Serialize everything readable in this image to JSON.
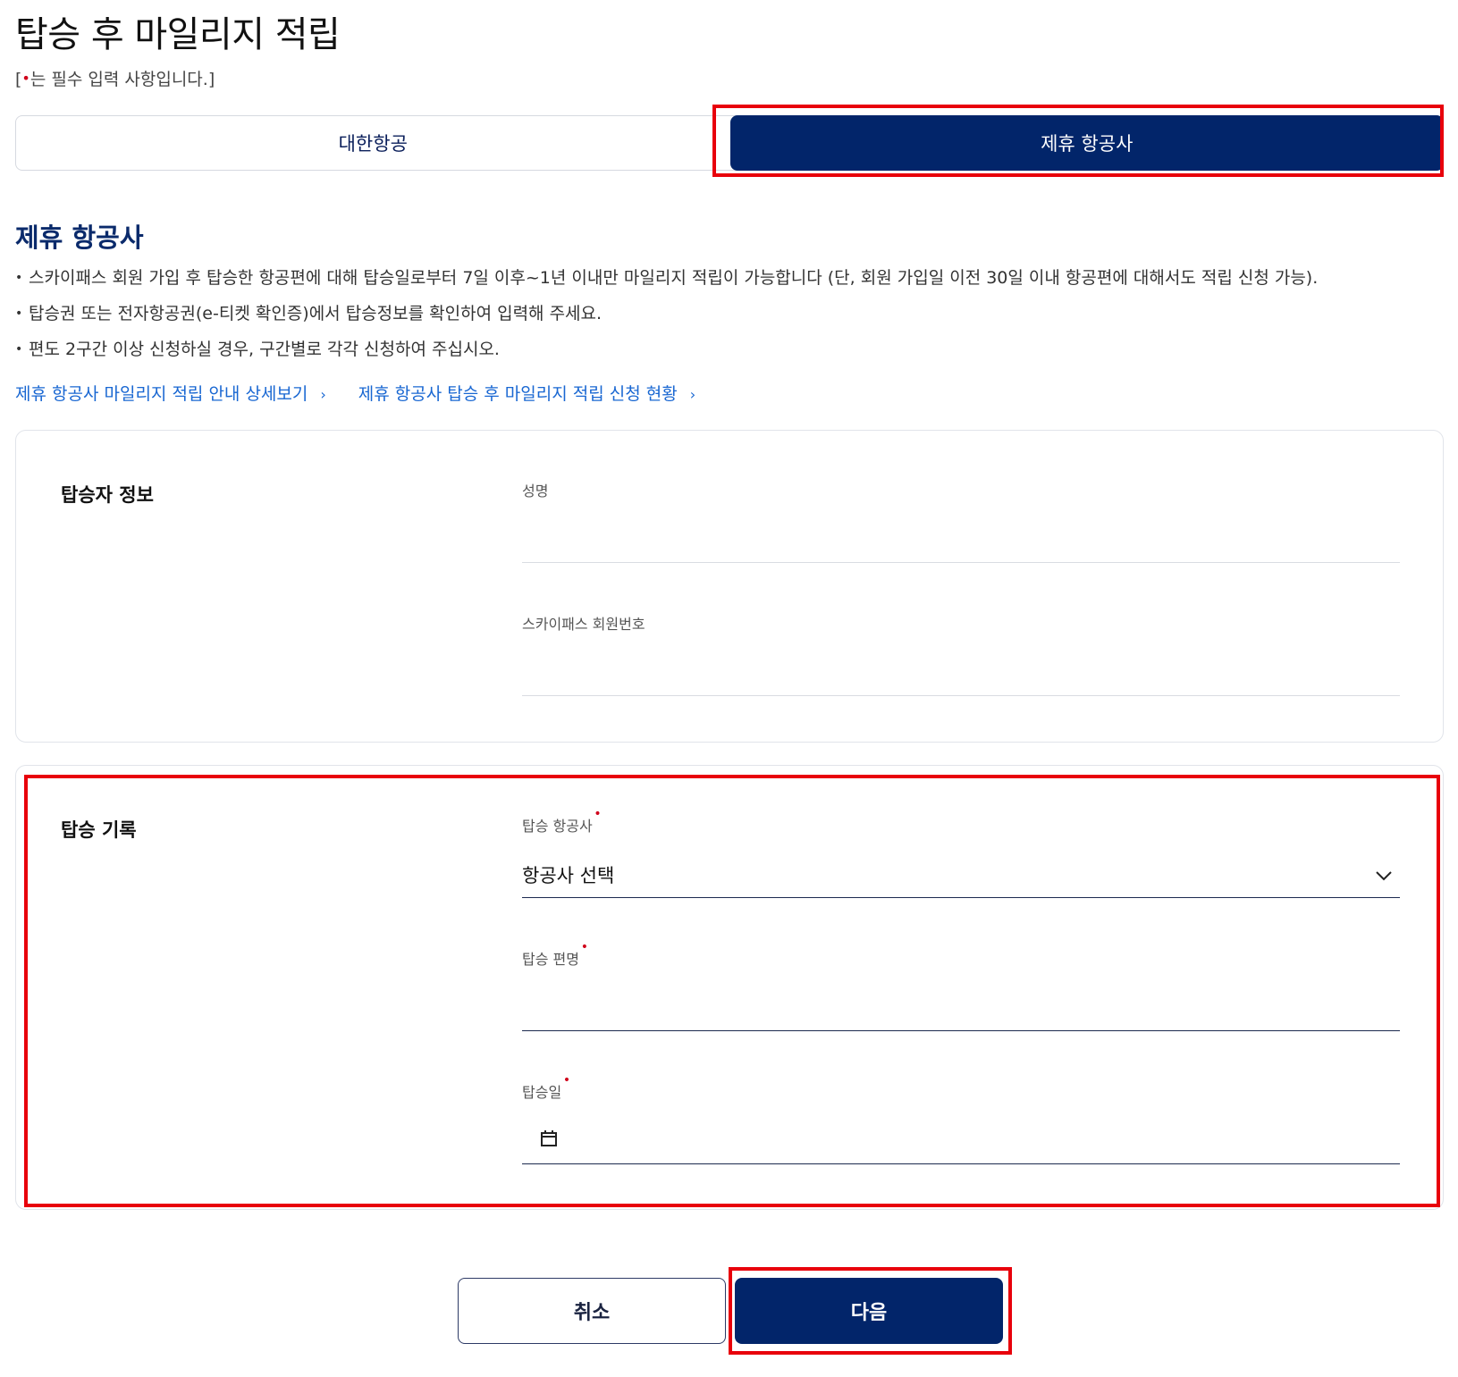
{
  "page": {
    "title": "탑승 후 마일리지 적립",
    "required_note_prefix": "[",
    "required_note_dot": "•",
    "required_note_suffix": "는 필수 입력 사항입니다.]"
  },
  "tabs": [
    {
      "label": "대한항공",
      "active": false
    },
    {
      "label": "제휴 항공사",
      "active": true
    }
  ],
  "section": {
    "title": "제휴 항공사",
    "notes": [
      "스카이패스 회원 가입 후 탑승한 항공편에 대해 탑승일로부터 7일 이후~1년 이내만 마일리지 적립이 가능합니다 (단, 회원 가입일 이전 30일 이내 항공편에 대해서도 적립 신청 가능).",
      "탑승권 또는 전자항공권(e-티켓 확인증)에서 탑승정보를 확인하여 입력해 주세요.",
      "편도 2구간 이상 신청하실 경우, 구간별로 각각 신청하여 주십시오."
    ],
    "links": [
      {
        "label": "제휴 항공사 마일리지 적립 안내 상세보기",
        "chevron": "›"
      },
      {
        "label": "제휴 항공사 탑승 후 마일리지 적립 신청 현황",
        "chevron": "›"
      }
    ]
  },
  "passenger_info": {
    "title": "탑승자 정보",
    "name_label": "성명",
    "name_value": "",
    "member_no_label": "스카이패스 회원번호",
    "member_no_value": ""
  },
  "boarding_record": {
    "title": "탑승 기록",
    "airline_label": "탑승 항공사",
    "airline_value": "항공사 선택",
    "flight_label": "탑승 편명",
    "flight_value": "",
    "date_label": "탑승일",
    "date_value": "",
    "required_mark": "•"
  },
  "buttons": {
    "cancel": "취소",
    "next": "다음"
  },
  "icons": {
    "select_chevron": "chevron-down-icon",
    "date_picker": "calendar-icon"
  },
  "colors": {
    "primary": "#02256a",
    "link": "#1967d2",
    "required": "#d0021b",
    "highlight": "#e8000b"
  }
}
